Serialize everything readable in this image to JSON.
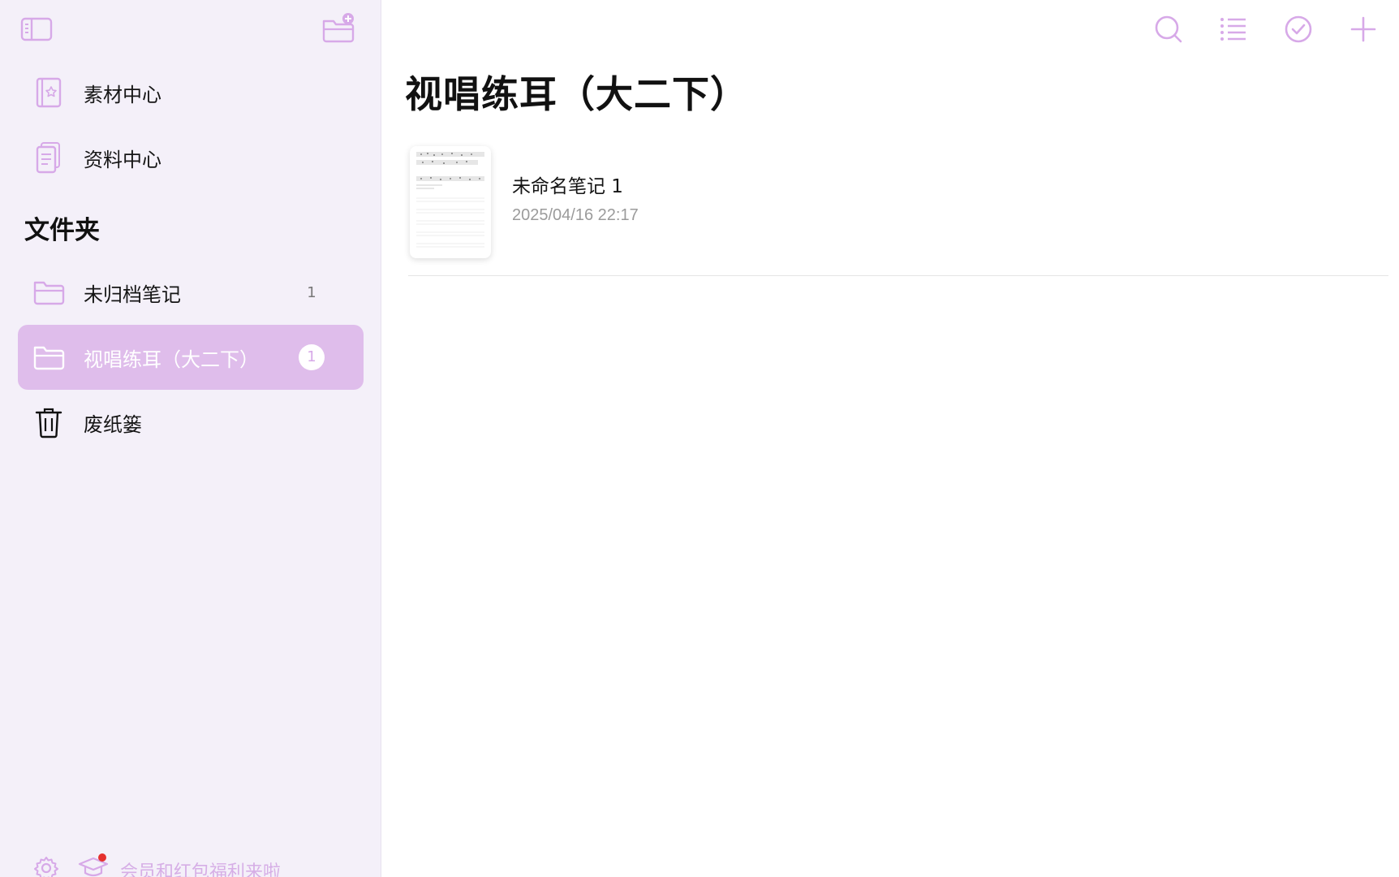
{
  "colors": {
    "accent": "#d7a9e8",
    "selected_bg": "#dfbdeb",
    "sidebar_bg": "#f4f0f9",
    "badge_dot": "#e5312e"
  },
  "toolbar": {
    "sidebar_toggle_icon": "sidebar-icon",
    "new_folder_icon": "folder-plus-icon",
    "search_icon": "search-icon",
    "list_icon": "list-icon",
    "select_icon": "check-circle-icon",
    "add_icon": "plus-icon"
  },
  "sidebar": {
    "top_items": [
      {
        "label": "素材中心",
        "icon": "sticker-book-icon"
      },
      {
        "label": "资料中心",
        "icon": "document-icon"
      }
    ],
    "folders_title": "文件夹",
    "folders": [
      {
        "label": "未归档笔记",
        "count": "1",
        "icon": "folder-icon"
      },
      {
        "label": "视唱练耳（大二下）",
        "count": "1",
        "icon": "folder-icon",
        "selected": true
      }
    ],
    "trash": {
      "label": "废纸篓",
      "icon": "trash-icon"
    },
    "footer": {
      "settings_icon": "gear-icon",
      "promo_icon": "graduation-cap-icon",
      "promo_text": "会员和红包福利来啦"
    }
  },
  "main": {
    "title": "视唱练耳（大二下）",
    "notes": [
      {
        "title": "未命名笔记 1",
        "date": "2025/04/16 22:17"
      }
    ]
  }
}
